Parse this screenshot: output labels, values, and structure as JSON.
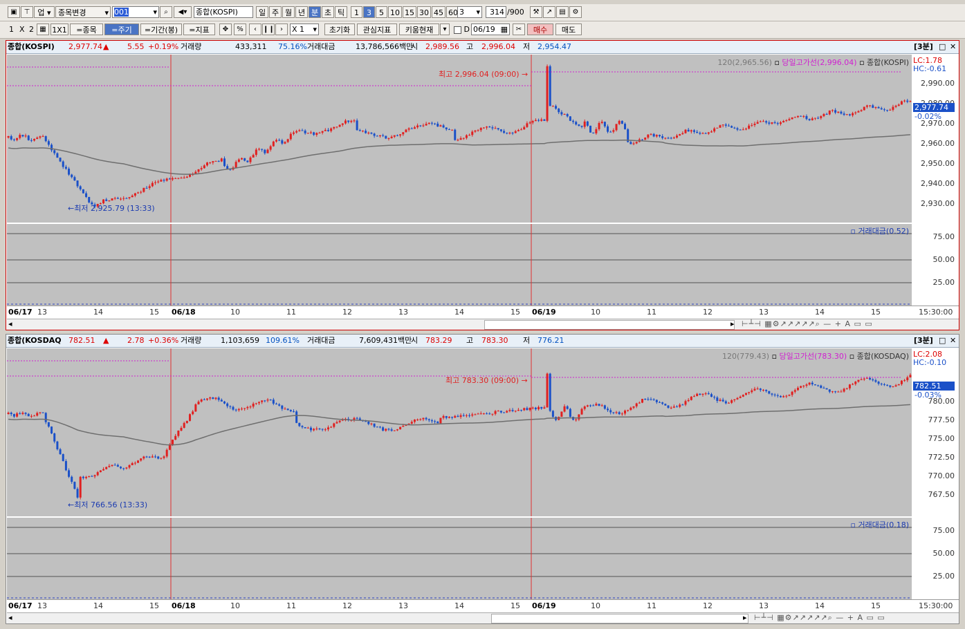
{
  "toolbar1": {
    "market_select": "업",
    "stock_change": "종목변경",
    "code_value": "001",
    "index_name": "종합(KOSPI)",
    "period_buttons": [
      "일",
      "주",
      "월",
      "년",
      "분",
      "초",
      "틱"
    ],
    "minute_buttons": [
      "1",
      "3",
      "5",
      "10",
      "15",
      "30",
      "45",
      "60"
    ],
    "count_value": "3",
    "bars_value": "314",
    "bars_total": "/900"
  },
  "toolbar2": {
    "layout_1": "1",
    "layout_x": "X",
    "layout_2": "2",
    "grid_1x1": "1X1",
    "same_stock": "=종목",
    "same_period": "=주기",
    "same_range": "=기간(봉)",
    "same_indicator": "=지표",
    "zoom_label": "X 1",
    "reset": "초기화",
    "watch_indicator": "관심지표",
    "kiwoom_now": "키움현재",
    "date_check": "D",
    "date_value": "06/19",
    "buy": "매수",
    "sell": "매도"
  },
  "panels": [
    {
      "header": {
        "name": "종합(KOSPI)",
        "price": "2,977.74",
        "arrow": "▲",
        "change": "5.55",
        "pct": "+0.19%",
        "vol_label": "거래량",
        "vol": "433,311",
        "vol_pct": "75.16%",
        "amt_label": "거래대금",
        "amt": "13,786,566백만",
        "open_label": "시",
        "open": "2,989.56",
        "high_label": "고",
        "high": "2,996.04",
        "low_label": "저",
        "low": "2,954.47",
        "interval": "[3분]"
      },
      "legend_ma": "120(2,965.56)",
      "legend_high": "당일고가선(2,996.04)",
      "legend_name": "종합(KOSPI)",
      "lc": "LC:1.78",
      "hc": "HC:-0.61",
      "price_tag": "2,977.74",
      "pct_tag": "-0.02%",
      "max_annot": "최고 2,996.04 (09:00)",
      "min_annot": "최저 2,925.79 (13:33)",
      "yticks": [
        "2,990.00",
        "2,980.00",
        "2,970.00",
        "2,960.00",
        "2,950.00",
        "2,940.00",
        "2,930.00"
      ],
      "sub_label": "거래대금(0.52)",
      "sub_ticks": [
        "75.00",
        "50.00",
        "25.00"
      ],
      "x_labels": [
        "06/17",
        "13",
        "14",
        "15",
        "06/18",
        "10",
        "11",
        "12",
        "13",
        "14",
        "15",
        "06/19",
        "10",
        "11",
        "12",
        "13",
        "14",
        "15"
      ],
      "x_end": "15:30:00"
    },
    {
      "header": {
        "name": "종합(KOSDAQ",
        "price": "782.51",
        "arrow": "▲",
        "change": "2.78",
        "pct": "+0.36%",
        "vol_label": "거래량",
        "vol": "1,103,659",
        "vol_pct": "109.61%",
        "amt_label": "거래대금",
        "amt": "7,609,431백만",
        "open_label": "시",
        "open": "783.29",
        "high_label": "고",
        "high": "783.30",
        "low_label": "저",
        "low": "776.21",
        "interval": "[3분]"
      },
      "legend_ma": "120(779.43)",
      "legend_high": "당일고가선(783.30)",
      "legend_name": "종합(KOSDAQ)",
      "lc": "LC:2.08",
      "hc": "HC:-0.10",
      "price_tag": "782.51",
      "pct_tag": "-0.03%",
      "max_annot": "최고 783.30 (09:00)",
      "min_annot": "최저 766.56 (13:33)",
      "yticks": [
        "780.00",
        "777.50",
        "775.00",
        "772.50",
        "770.00",
        "767.50"
      ],
      "sub_label": "거래대금(0.18)",
      "sub_ticks": [
        "75.00",
        "50.00",
        "25.00"
      ],
      "x_labels": [
        "06/17",
        "13",
        "14",
        "15",
        "06/18",
        "10",
        "11",
        "12",
        "13",
        "14",
        "15",
        "06/19",
        "10",
        "11",
        "12",
        "13",
        "14",
        "15"
      ],
      "x_end": "15:30:00"
    }
  ],
  "colors": {
    "up": "#e02020",
    "down": "#1a50c8",
    "ma": "#6e6e6e",
    "highline": "#d020d0",
    "bg": "#c0c0c0"
  }
}
